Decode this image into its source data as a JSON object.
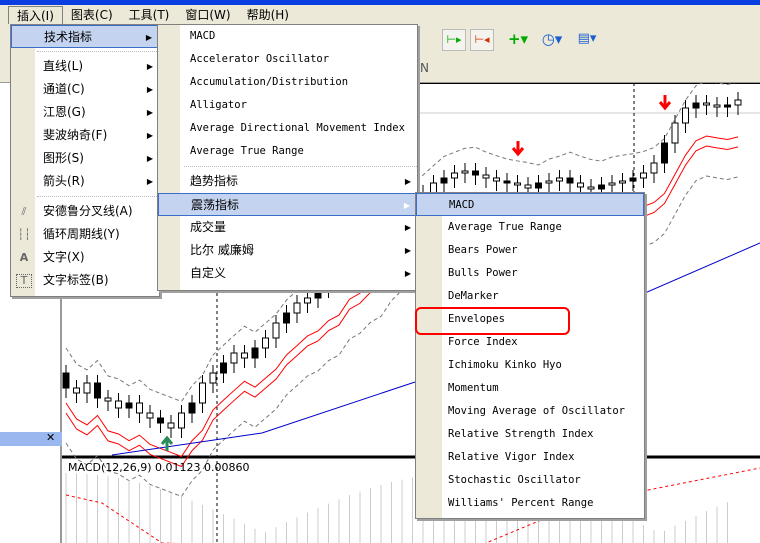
{
  "menubar": [
    "插入(I)",
    "图表(C)",
    "工具(T)",
    "窗口(W)",
    "帮助(H)"
  ],
  "insert_menu": {
    "items": [
      {
        "label": "技术指标",
        "icon": "",
        "submenu": true
      },
      {
        "label": "直线(L)",
        "submenu": true
      },
      {
        "label": "通道(C)",
        "submenu": true
      },
      {
        "label": "江恩(G)",
        "submenu": true
      },
      {
        "label": "斐波纳奇(F)",
        "submenu": true
      },
      {
        "label": "图形(S)",
        "submenu": true
      },
      {
        "label": "箭头(R)",
        "submenu": true
      },
      {
        "label": "安德鲁分叉线(A)",
        "icon": "andrews-pitchfork-icon"
      },
      {
        "label": "循环周期线(Y)",
        "icon": "cycle-lines-icon"
      },
      {
        "label": "文字(X)",
        "icon": "text-icon"
      },
      {
        "label": "文字标签(B)",
        "icon": "text-label-icon"
      }
    ]
  },
  "indicators_menu": {
    "items": [
      "MACD",
      "Accelerator Oscillator",
      "Accumulation/Distribution",
      "Alligator",
      "Average Directional Movement Index",
      "Average True Range"
    ],
    "submenus": [
      "趋势指标",
      "震荡指标",
      "成交量",
      "比尔 威廉姆",
      "自定义"
    ]
  },
  "oscillators_menu": {
    "items": [
      "MACD",
      "Average True Range",
      "Bears Power",
      "Bulls Power",
      "DeMarker",
      "Envelopes",
      "Force Index",
      "Ichimoku Kinko Hyo",
      "Momentum",
      "Moving Average of Oscillator",
      "Relative Strength Index",
      "Relative Vigor Index",
      "Stochastic Oscillator",
      "Williams' Percent Range"
    ],
    "highlighted": "Envelopes"
  },
  "chart": {
    "macd_label": "MACD(12,26,9) 0.01123 0.00860",
    "tab_fragment": "N"
  },
  "colors": {
    "highlight": "#ff0000",
    "selection": "#c4d3ef",
    "ma_blue": "#0000cc",
    "envelope_red": "#ff0000"
  }
}
